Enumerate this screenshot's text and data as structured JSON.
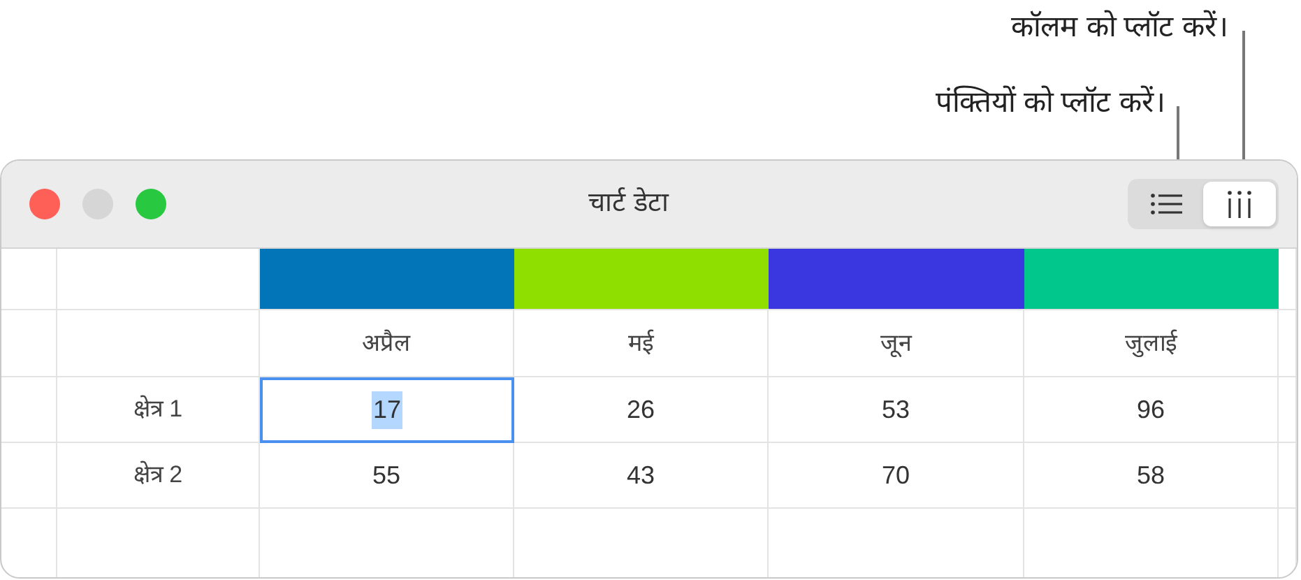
{
  "callouts": [
    {
      "text": "कॉलम को प्लॉट करें।"
    },
    {
      "text": "पंक्तियों को प्लॉट करें।"
    }
  ],
  "window": {
    "title": "चार्ट डेटा"
  },
  "plot_toggle": [
    {
      "kind": "rows",
      "selected": false
    },
    {
      "kind": "columns",
      "selected": true
    }
  ],
  "table": {
    "columns": [
      {
        "label": "अप्रैल",
        "color": "#0274b8"
      },
      {
        "label": "मई",
        "color": "#8fdf00"
      },
      {
        "label": "जून",
        "color": "#3b37e0"
      },
      {
        "label": "जुलाई",
        "color": "#02c78d"
      }
    ],
    "rows": [
      {
        "label": "क्षेत्र 1",
        "cells": [
          {
            "value": "17",
            "selected": true
          },
          {
            "value": "26",
            "selected": false
          },
          {
            "value": "53",
            "selected": false
          },
          {
            "value": "96",
            "selected": false
          }
        ]
      },
      {
        "label": "क्षेत्र 2",
        "cells": [
          {
            "value": "55",
            "selected": false
          },
          {
            "value": "43",
            "selected": false
          },
          {
            "value": "70",
            "selected": false
          },
          {
            "value": "58",
            "selected": false
          }
        ]
      }
    ]
  }
}
